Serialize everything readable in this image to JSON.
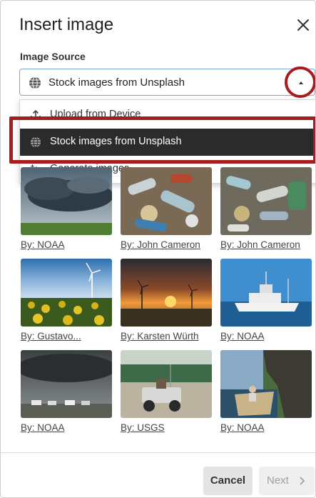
{
  "dialog": {
    "title": "Insert image",
    "close_icon": "close-icon"
  },
  "source": {
    "label": "Image Source",
    "selected": "Stock images from Unsplash",
    "icon": "globe-icon"
  },
  "menu": {
    "items": [
      {
        "label": "Upload from Device",
        "icon": "upload-icon"
      },
      {
        "label": "Stock images from Unsplash",
        "icon": "globe-icon",
        "selected": true
      },
      {
        "label": "Generate images",
        "icon": "sparkle-icon"
      }
    ]
  },
  "annotation_color": "#a51d1d",
  "images": [
    {
      "credit": "By: NOAA",
      "subject": "storm-clouds"
    },
    {
      "credit": "By: John Cameron",
      "subject": "plastic-waste"
    },
    {
      "credit": "By: John Cameron",
      "subject": "plastic-waste"
    },
    {
      "credit": "By: Gustavo...",
      "subject": "sunflowers-wind-turbine"
    },
    {
      "credit": "By: Karsten Würth",
      "subject": "sunset-wind-turbines"
    },
    {
      "credit": "By: NOAA",
      "subject": "research-ship"
    },
    {
      "credit": "By: NOAA",
      "subject": "tornado-storm"
    },
    {
      "credit": "By: USGS",
      "subject": "vehicle-dry-lake"
    },
    {
      "credit": "By: NOAA",
      "subject": "boat-rocks"
    }
  ],
  "footer": {
    "cancel": "Cancel",
    "next": "Next"
  }
}
